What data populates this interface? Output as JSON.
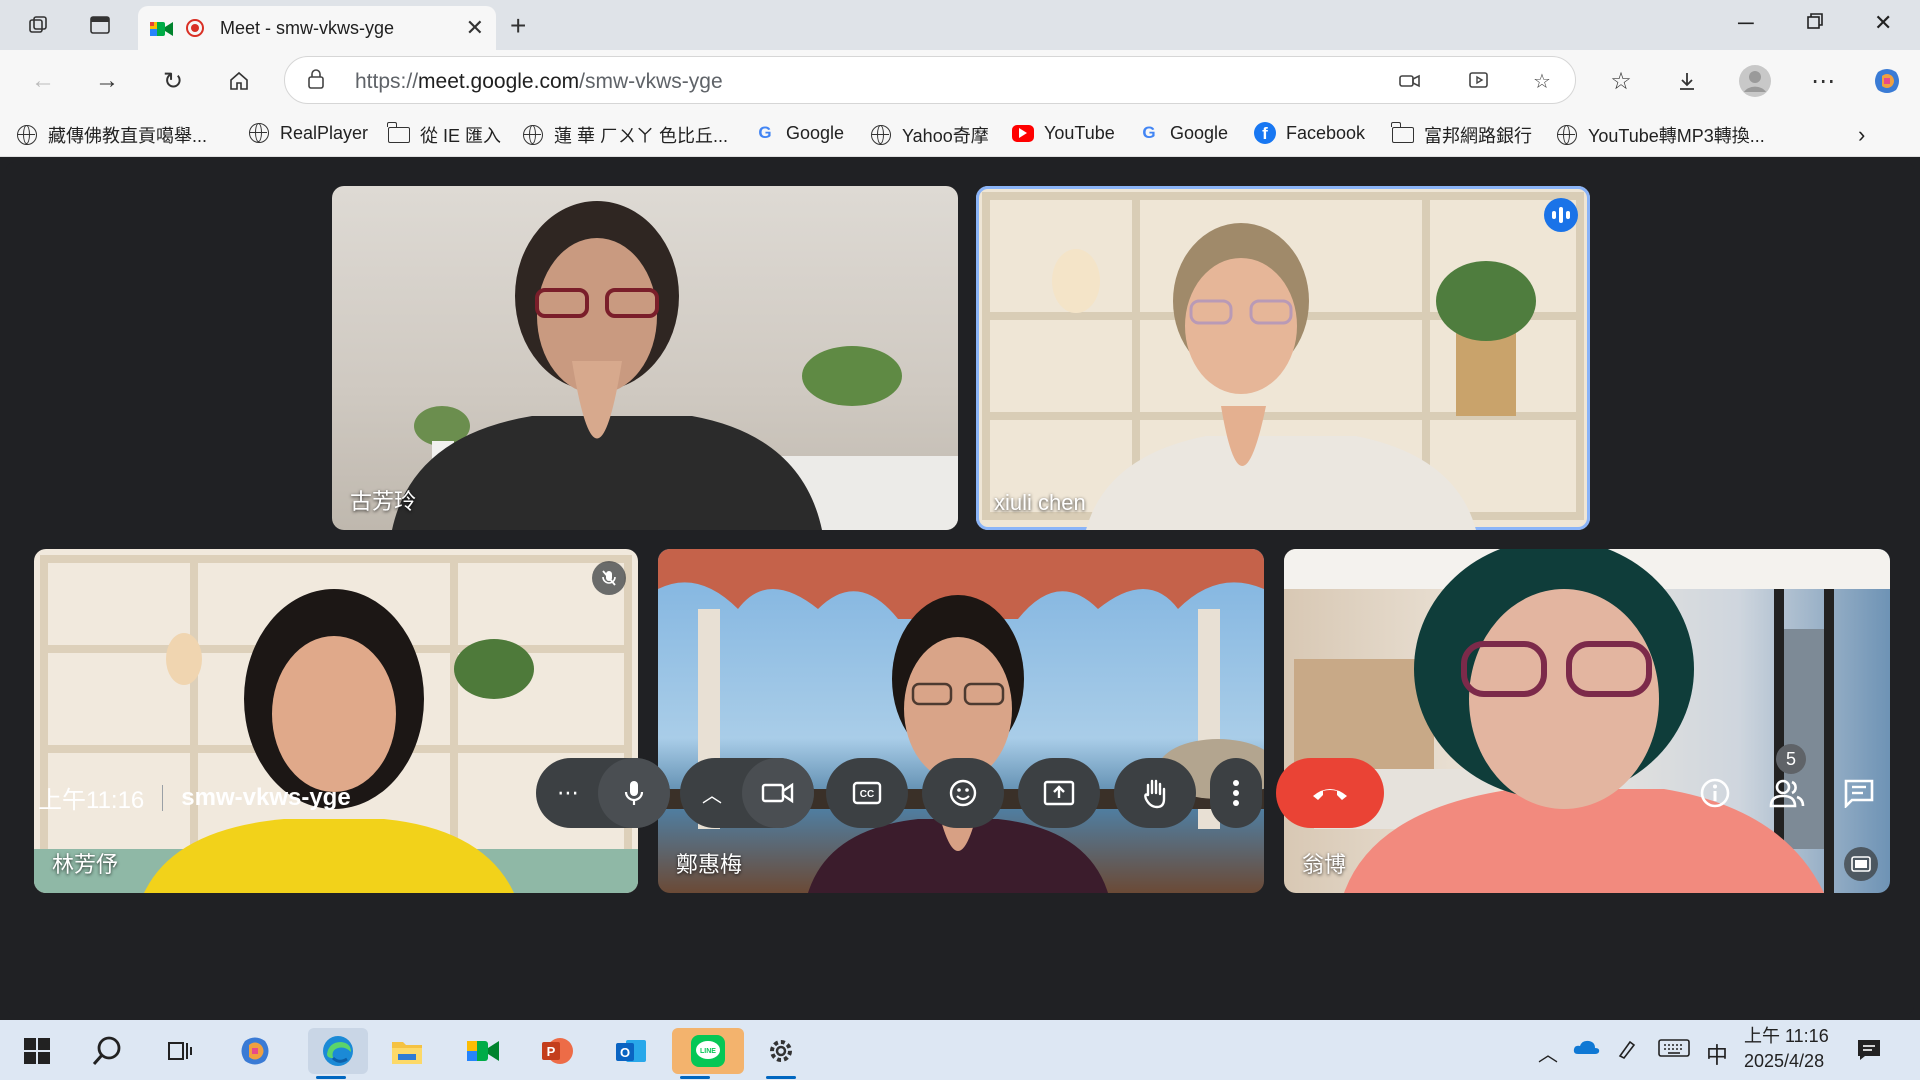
{
  "browser": {
    "tab_title": "Meet - smw-vkws-yge",
    "url_prefix": "https://",
    "url_host": "meet.google.com",
    "url_path": "/smw-vkws-yge"
  },
  "bookmarks": [
    {
      "label": "藏傳佛教直貢噶舉...",
      "icon": "globe-icon"
    },
    {
      "label": "RealPlayer",
      "icon": "globe-icon"
    },
    {
      "label": "從 IE 匯入",
      "icon": "folder-icon"
    },
    {
      "label": "蓮 華 ㄏㄨㄚ 色比丘...",
      "icon": "globe-icon"
    },
    {
      "label": "Google",
      "icon": "google-icon"
    },
    {
      "label": "Yahoo奇摩",
      "icon": "globe-icon"
    },
    {
      "label": "YouTube",
      "icon": "youtube-icon"
    },
    {
      "label": "Google",
      "icon": "google-icon"
    },
    {
      "label": "Facebook",
      "icon": "facebook-icon"
    },
    {
      "label": "富邦網路銀行",
      "icon": "folder-icon"
    },
    {
      "label": "YouTube轉MP3轉換...",
      "icon": "globe-icon"
    }
  ],
  "participants": [
    {
      "name": "古芳玲",
      "state": "normal"
    },
    {
      "name": "xiuli chen",
      "state": "speaking"
    },
    {
      "name": "林芳伃",
      "state": "muted"
    },
    {
      "name": "鄭惠梅",
      "state": "normal"
    },
    {
      "name": "翁博",
      "state": "pip"
    }
  ],
  "meeting": {
    "time": "上午11:16",
    "code": "smw-vkws-yge",
    "participant_count": "5",
    "hangup_color": "#ea4335",
    "speaking_color": "#1a73e8"
  },
  "taskbar": {
    "time": "上午 11:16",
    "date": "2025/4/28",
    "ime": "中"
  }
}
